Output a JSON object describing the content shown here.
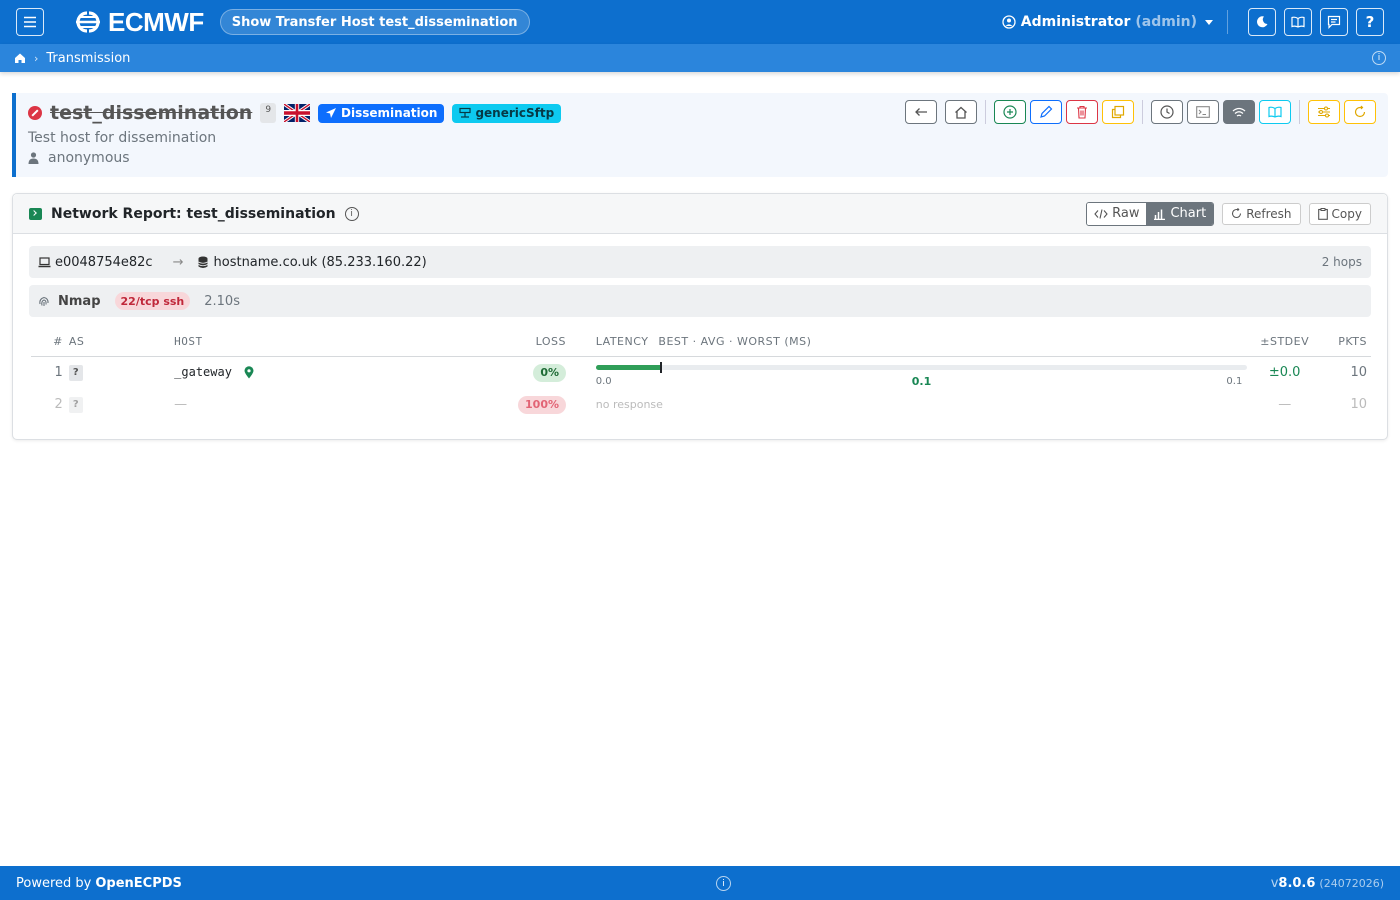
{
  "navbar": {
    "brand": "ECMWF",
    "page_title": "Show Transfer Host test_dissemination",
    "user_name": "Administrator",
    "user_login": "(admin)"
  },
  "breadcrumb": {
    "items": [
      "Transmission"
    ]
  },
  "host": {
    "name": "test_dissemination",
    "count": "9",
    "description": "Test host for dissemination",
    "owner": "anonymous",
    "type_badge": "Dissemination",
    "method_badge": "genericSftp",
    "status": "disabled",
    "country": "GB"
  },
  "report": {
    "title": "Network Report: test_dissemination",
    "view_raw": "Raw",
    "view_chart": "Chart",
    "refresh": "Refresh",
    "copy": "Copy",
    "source": "e0048754e82c",
    "destination": "hostname.co.uk (85.233.160.22)",
    "hops_count": "2 hops",
    "nmap": {
      "title": "Nmap",
      "port": "22/tcp ssh",
      "duration": "2.10s"
    },
    "columns": {
      "num": "#",
      "as": "AS",
      "host": "HOST",
      "loss": "LOSS",
      "latency": "LATENCY",
      "latency_sub": "BEST · AVG · WORST (MS)",
      "stdev": "±STDEV",
      "pkts": "PKTS"
    },
    "rows": [
      {
        "num": "1",
        "as": "?",
        "host": "_gateway",
        "loss": "0%",
        "best": "0.0",
        "avg": "0.1",
        "worst": "0.1",
        "best_fraction": 0.1,
        "stdev": "±0.0",
        "pkts": "10"
      },
      {
        "num": "2",
        "as": "?",
        "host": "—",
        "loss": "100%",
        "no_response": "no response",
        "stdev": "—",
        "pkts": "10"
      }
    ]
  },
  "footer": {
    "powered_by": "Powered by",
    "product": "OpenECPDS",
    "version_prefix": "v",
    "version": "8.0.6",
    "build": "(24072026)"
  },
  "colors": {
    "primary": "#0d6fce",
    "danger": "#dc3545",
    "success": "#198754"
  }
}
